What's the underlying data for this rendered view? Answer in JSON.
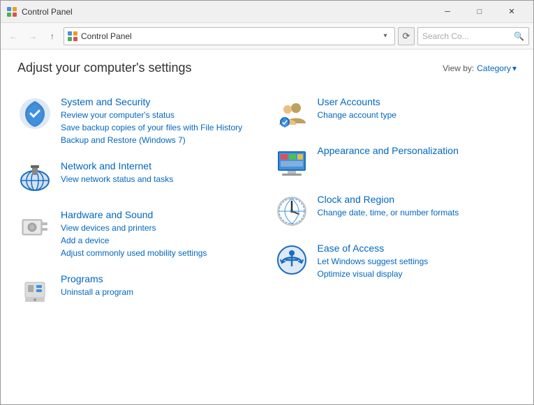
{
  "titlebar": {
    "icon": "control-panel-icon",
    "title": "Control Panel",
    "minimize": "─",
    "maximize": "□",
    "close": "✕"
  },
  "addressbar": {
    "back_label": "←",
    "forward_label": "→",
    "up_label": "↑",
    "address": "Control Panel",
    "refresh_label": "⟳",
    "search_placeholder": "Search Co...",
    "search_icon": "🔍",
    "dropdown_label": "▾"
  },
  "page": {
    "title": "Adjust your computer's settings",
    "viewby_label": "View by:",
    "viewby_value": "Category",
    "viewby_dropdown": "▾"
  },
  "categories": {
    "left": [
      {
        "id": "system-security",
        "title": "System and Security",
        "links": [
          "Review your computer's status",
          "Save backup copies of your files with File History",
          "Backup and Restore (Windows 7)"
        ]
      },
      {
        "id": "network-internet",
        "title": "Network and Internet",
        "links": [
          "View network status and tasks"
        ]
      },
      {
        "id": "hardware-sound",
        "title": "Hardware and Sound",
        "links": [
          "View devices and printers",
          "Add a device",
          "Adjust commonly used mobility settings"
        ]
      },
      {
        "id": "programs",
        "title": "Programs",
        "links": [
          "Uninstall a program"
        ]
      }
    ],
    "right": [
      {
        "id": "user-accounts",
        "title": "User Accounts",
        "links": [
          "Change account type"
        ]
      },
      {
        "id": "appearance",
        "title": "Appearance and Personalization",
        "links": []
      },
      {
        "id": "clock-region",
        "title": "Clock and Region",
        "links": [
          "Change date, time, or number formats"
        ]
      },
      {
        "id": "ease-of-access",
        "title": "Ease of Access",
        "links": [
          "Let Windows suggest settings",
          "Optimize visual display"
        ]
      }
    ]
  }
}
